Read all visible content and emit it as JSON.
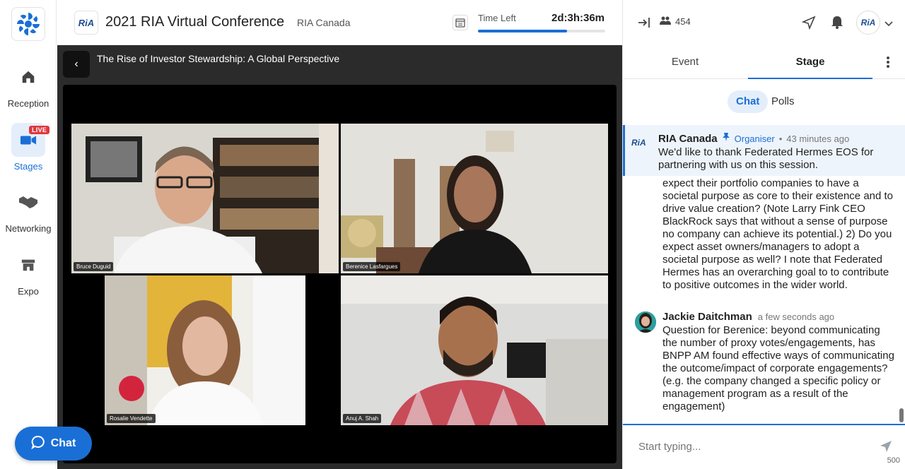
{
  "nav": {
    "items": [
      {
        "label": "Reception",
        "icon": "home-icon"
      },
      {
        "label": "Stages",
        "icon": "video-camera-icon",
        "badge": "LIVE"
      },
      {
        "label": "Networking",
        "icon": "handshake-icon"
      },
      {
        "label": "Expo",
        "icon": "store-icon"
      }
    ]
  },
  "header": {
    "logo_text": "RiA",
    "title": "2021 RIA Virtual Conference",
    "organizer": "RIA Canada",
    "time_left_label": "Time Left",
    "time_left_value": "2d:3h:36m",
    "time_left_progress": 0.7
  },
  "stage": {
    "session_title": "The Rise of Investor Stewardship: A Global Perspective",
    "participants": [
      {
        "name": "Bruce Duguid"
      },
      {
        "name": "Berenice Lasfargues"
      },
      {
        "name": "Rosalie Vendette"
      },
      {
        "name": "Anuj A. Shah"
      }
    ]
  },
  "chat_fab_label": "Chat",
  "right_panel": {
    "attendee_count": "454",
    "avatar_text": "RiA",
    "tabs": [
      "Event",
      "Stage"
    ],
    "active_tab": "Stage",
    "subtabs": [
      "Chat",
      "Polls"
    ],
    "active_subtab": "Chat",
    "pinned": {
      "sender": "RIA Canada",
      "role": "Organiser",
      "time": "43 minutes ago",
      "text": "We'd like to thank Federated Hermes EOS for partnering with us on this session."
    },
    "messages": [
      {
        "sender": "",
        "time": "",
        "text": "expect their portfolio companies to have a societal purpose as core to their existence and to drive value creation? (Note Larry Fink CEO BlackRock says that without a sense of purpose no company can achieve its potential.) 2) Do you expect asset owners/managers to adopt a societal purpose as well? I note that Federated Hermes has an overarching goal to to contribute to positive outcomes in the wider world."
      },
      {
        "sender": "Jackie Daitchman",
        "time": "a few seconds ago",
        "text": "Question for Berenice: beyond communicating the number of proxy votes/engagements, has BNPP AM found effective ways of communicating the outcome/impact of corporate engagements? (e.g. the company changed a specific policy or management program as a result of the engagement)"
      }
    ],
    "composer_placeholder": "Start typing...",
    "char_limit": "500"
  }
}
